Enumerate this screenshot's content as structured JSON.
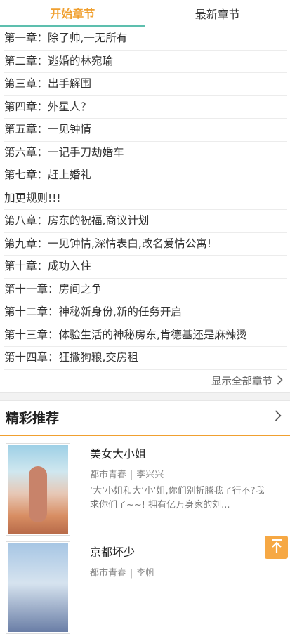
{
  "tabs": [
    {
      "label": "开始章节",
      "active": true
    },
    {
      "label": "最新章节",
      "active": false
    }
  ],
  "chapters": [
    "第一章：除了帅,一无所有",
    "第二章：逃婚的林宛瑜",
    "第三章：出手解围",
    "第四章：外星人？",
    "第五章：一见钟情",
    "第六章：一记手刀劫婚车",
    "第七章：赶上婚礼",
    "加更规则!!!",
    "第八章：房东的祝福,商议计划",
    "第九章：一见钟情,深情表白,改名爱情公寓!",
    "第十章：成功入住",
    "第十一章：房间之争",
    "第十二章：神秘新身份,新的任务开启",
    "第十三章：体验生活的神秘房东,肯德基还是麻辣烫",
    "第十四章：狂撒狗粮,交房租"
  ],
  "show_all_label": "显示全部章节",
  "recommend": {
    "title": "精彩推荐",
    "books": [
      {
        "title": "美女大小姐",
        "category": "都市青春",
        "author": "李兴兴",
        "desc": "‘大‘小姐和大‘小‘姐,你们别折腾我了行不?我求你们了~~! 拥有亿万身家的刘..."
      },
      {
        "title": "京都坏少",
        "category": "都市青春",
        "author": "李帆",
        "desc": ""
      }
    ]
  },
  "colors": {
    "accent": "#f0a030",
    "tab_underline": "#5dbfae",
    "top_button": "#f6a844"
  },
  "icons": {
    "chevron": "chevron-right-icon",
    "top": "back-to-top-icon"
  }
}
